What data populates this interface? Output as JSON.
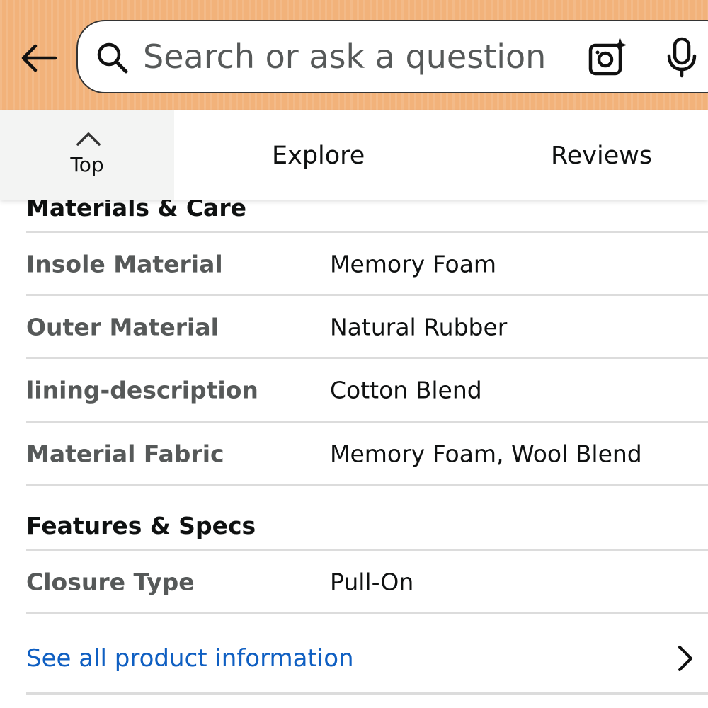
{
  "header": {
    "search": {
      "placeholder": "Search or ask a question"
    },
    "icons": [
      "back-arrow-icon",
      "search-icon",
      "camera-sparkle-icon",
      "microphone-icon"
    ],
    "color": "#f2b27a"
  },
  "tabs": {
    "top_label": "Top",
    "explore_label": "Explore",
    "reviews_label": "Reviews"
  },
  "sections": [
    {
      "title": "Materials & Care",
      "rows": [
        {
          "key": "Insole Material",
          "value": "Memory Foam"
        },
        {
          "key": "Outer Material",
          "value": "Natural Rubber"
        },
        {
          "key": "lining-description",
          "value": "Cotton Blend"
        },
        {
          "key": "Material Fabric",
          "value": "Memory Foam, Wool Blend"
        }
      ]
    },
    {
      "title": "Features & Specs",
      "rows": [
        {
          "key": "Closure Type",
          "value": "Pull-On"
        }
      ]
    }
  ],
  "see_all": {
    "label": "See all product information",
    "color": "#0f5fc2"
  }
}
